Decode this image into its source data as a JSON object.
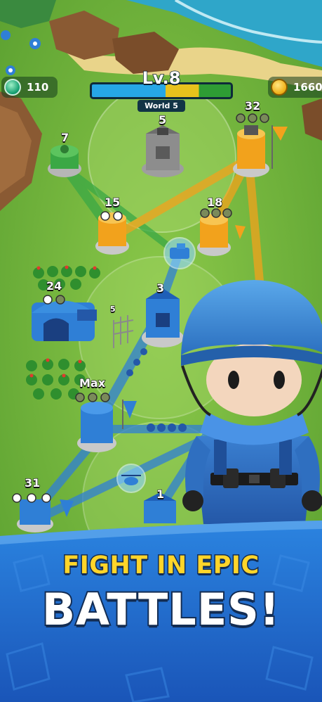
{
  "hud": {
    "gems": "110",
    "coins": "1660",
    "level_label": "Lv.8",
    "world_label": "World 5",
    "level_progress": 0.53
  },
  "map": {
    "labels": {
      "tower_7": "7",
      "tower_5": "5",
      "tower_32": "32",
      "tower_15": "15",
      "tower_18": "18",
      "barracks_24": "24",
      "tower_3": "3",
      "fence_5": "5",
      "tower_max": "Max",
      "tower_31": "31",
      "tower_1": "1"
    }
  },
  "banner": {
    "line1": "FIGHT IN EPIC",
    "line2": "BATTLES!"
  },
  "colors": {
    "grass": "#6db43a",
    "blue_team": "#2f7fd6",
    "orange_team": "#f2a21c",
    "green_team": "#3aa845",
    "banner_blue": "#1f63c7",
    "headline_yellow": "#ffd52a"
  }
}
